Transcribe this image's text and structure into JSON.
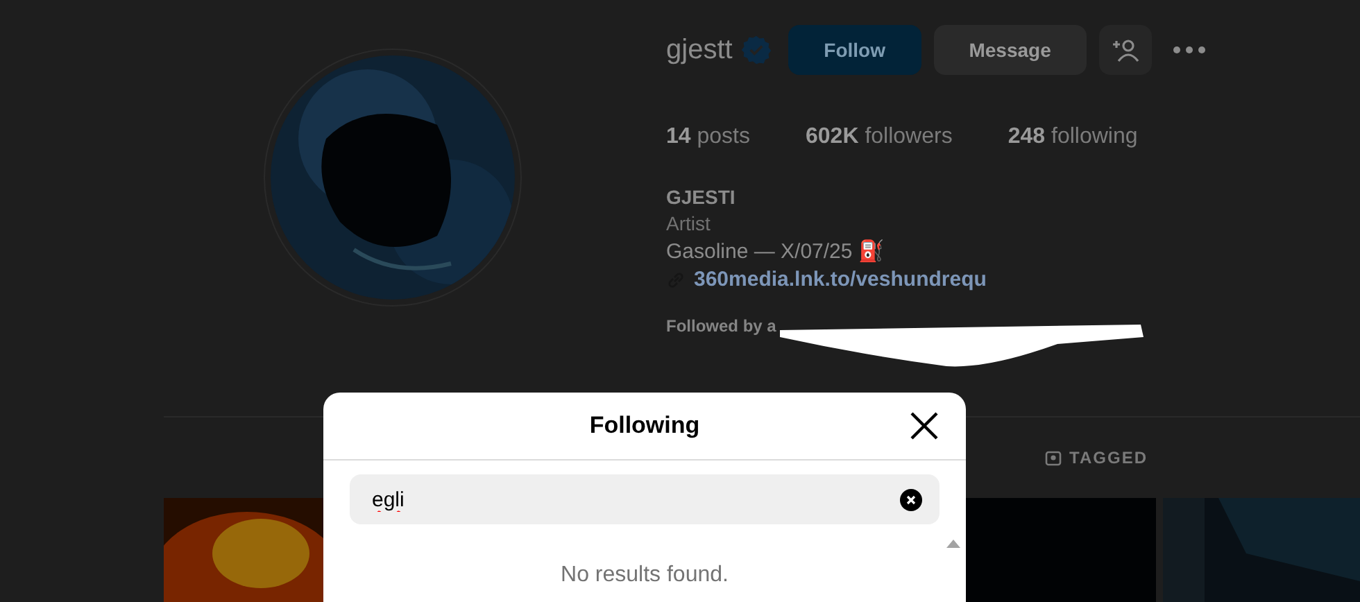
{
  "profile": {
    "username": "gjestt",
    "verified": true,
    "follow_button": "Follow",
    "message_button": "Message",
    "stats": [
      {
        "value": "14",
        "label": "posts"
      },
      {
        "value": "602K",
        "label": "followers"
      },
      {
        "value": "248",
        "label": "following"
      }
    ],
    "full_name": "GJESTI",
    "category": "Artist",
    "bio": "Gasoline — X/07/25 ⛽",
    "link": "360media.lnk.to/veshundrequ",
    "followed_by": "Followed by a"
  },
  "tabs": [
    {
      "label": "TAGGED",
      "selected": false
    }
  ],
  "dialog": {
    "title": "Following",
    "search": {
      "value": "egli"
    },
    "empty_message": "No results found."
  }
}
